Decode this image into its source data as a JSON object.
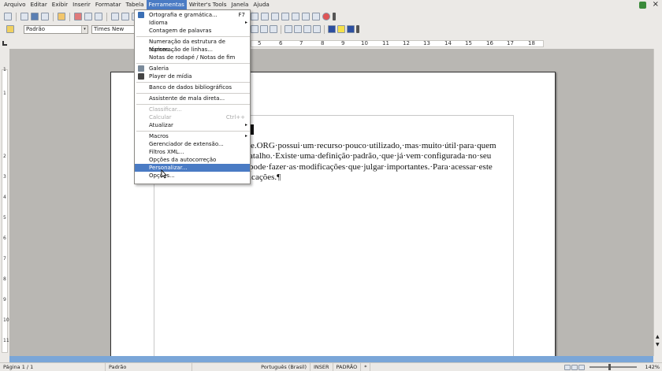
{
  "menubar": {
    "items": [
      "Arquivo",
      "Editar",
      "Exibir",
      "Inserir",
      "Formatar",
      "Tabela",
      "Ferramentas",
      "Writer's Tools",
      "Janela",
      "Ajuda"
    ],
    "active": "Ferramentas",
    "close": "×"
  },
  "formatting": {
    "style_value": "Padrão",
    "font_value": "Times New Roma",
    "dropdown_arrow": "▾"
  },
  "ruler": {
    "ticks": [
      "5",
      "6",
      "7",
      "8",
      "9",
      "10",
      "11",
      "12",
      "13",
      "14",
      "15",
      "16",
      "17",
      "18"
    ]
  },
  "vruler": {
    "ticks": [
      "1",
      "1",
      "2",
      "3",
      "4",
      "5",
      "6",
      "7",
      "8",
      "9",
      "10",
      "11"
    ]
  },
  "document": {
    "lines": [
      "ice.ORG·possui·um·recurso·pouco·utilizado,·mas·muito·útil·para·quem",
      "atalho.·Existe·uma·definição·padrão,·que·já·vem·configurada·no·seu",
      "pode·fazer·as·modificações·que·julgar·importantes.·Para·acessar·este",
      "icações.¶"
    ]
  },
  "menu": {
    "items": [
      {
        "label": "Ortografia e gramática...",
        "shortcut": "F7",
        "icon": "spellcheck-icon",
        "enabled": true
      },
      {
        "label": "Idioma",
        "submenu": true,
        "enabled": true
      },
      {
        "label": "Contagem de palavras",
        "enabled": true
      },
      {
        "separator": true
      },
      {
        "label": "Numeração da estrutura de tópicos...",
        "enabled": true
      },
      {
        "label": "Numeração de linhas...",
        "enabled": true
      },
      {
        "label": "Notas de rodapé / Notas de fim",
        "enabled": true
      },
      {
        "separator": true
      },
      {
        "label": "Galeria",
        "icon": "gallery-icon",
        "enabled": true
      },
      {
        "label": "Player de mídia",
        "icon": "media-player-icon",
        "enabled": true
      },
      {
        "separator": true
      },
      {
        "label": "Banco de dados bibliográficos",
        "enabled": true
      },
      {
        "separator": true
      },
      {
        "label": "Assistente de mala direta...",
        "enabled": true
      },
      {
        "separator": true
      },
      {
        "label": "Classificar...",
        "enabled": false
      },
      {
        "label": "Calcular",
        "shortcut": "Ctrl++",
        "enabled": false
      },
      {
        "label": "Atualizar",
        "submenu": true,
        "enabled": true
      },
      {
        "separator": true
      },
      {
        "label": "Macros",
        "submenu": true,
        "enabled": true
      },
      {
        "label": "Gerenciador de extensão...",
        "enabled": true
      },
      {
        "label": "Filtros XML...",
        "enabled": true
      },
      {
        "label": "Opções da autocorreção",
        "enabled": true
      },
      {
        "label": "Personalizar...",
        "enabled": true,
        "highlighted": true
      },
      {
        "label": "Opções...",
        "enabled": true
      }
    ],
    "submenu_arrow": "▸"
  },
  "status": {
    "page": "Página 1 / 1",
    "style": "Padrão",
    "language": "Português (Brasil)",
    "insert_mode": "INSER",
    "selection_mode": "PADRÃO",
    "modified": "*",
    "zoom": "142%"
  },
  "colors": {
    "menu_highlight": "#4a7bc4",
    "chrome": "#ebe9e6",
    "doc_background": "#b9b7b3"
  }
}
